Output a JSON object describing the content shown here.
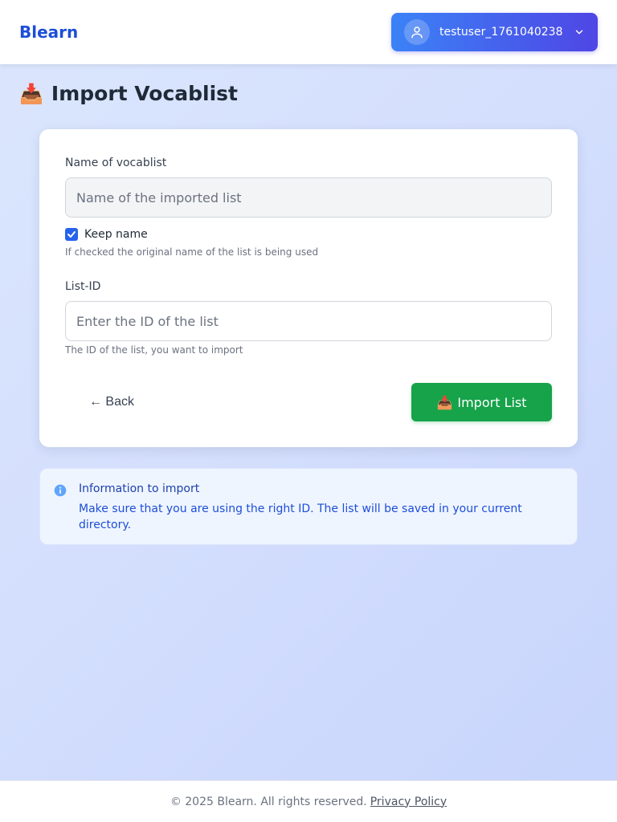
{
  "header": {
    "brand": "Blearn",
    "username": "testuser_1761040238"
  },
  "page": {
    "title_icon": "📥",
    "title": "Import Vocablist"
  },
  "form": {
    "name_label": "Name of vocablist",
    "name_placeholder": "Name of the imported list",
    "keep_name_label": "Keep name",
    "keep_name_checked": true,
    "keep_name_help": "If checked the original name of the list is being used",
    "list_id_label": "List-ID",
    "list_id_placeholder": "Enter the ID of the list",
    "list_id_help": "The ID of the list, you want to import",
    "back_label": "← Back",
    "import_icon": "📥",
    "import_label": "Import List"
  },
  "info": {
    "title": "Information to import",
    "text": "Make sure that you are using the right ID. The list will be saved in your current directory."
  },
  "footer": {
    "copyright": "© 2025 Blearn. All rights reserved.",
    "privacy_link": "Privacy Policy"
  },
  "colors": {
    "brand": "#1d4ed8",
    "primary": "#2563eb",
    "success": "#16a34a",
    "user_menu_gradient_start": "#3b82f6",
    "user_menu_gradient_end": "#4f46e5"
  },
  "icons": {
    "avatar": "user-icon",
    "dropdown": "chevron-down-icon",
    "info": "info-circle-icon",
    "checkbox": "checkmark-icon"
  }
}
